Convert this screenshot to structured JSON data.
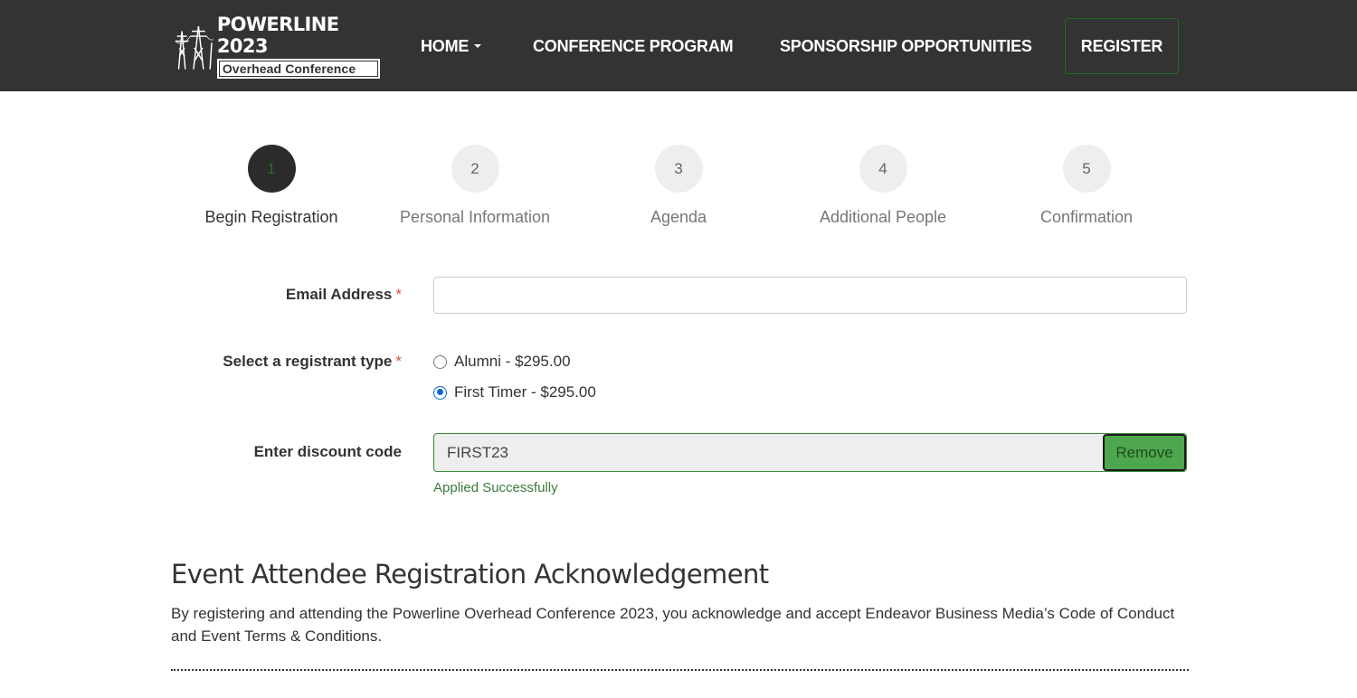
{
  "header": {
    "logo_title": "POWERLINE 2023",
    "logo_subtitle": "Overhead Conference",
    "nav": {
      "home": "HOME",
      "program": "CONFERENCE PROGRAM",
      "sponsorship": "SPONSORSHIP OPPORTUNITIES",
      "register": "REGISTER"
    }
  },
  "steps": [
    {
      "number": "1",
      "label": "Begin Registration",
      "active": true
    },
    {
      "number": "2",
      "label": "Personal Information",
      "active": false
    },
    {
      "number": "3",
      "label": "Agenda",
      "active": false
    },
    {
      "number": "4",
      "label": "Additional People",
      "active": false
    },
    {
      "number": "5",
      "label": "Confirmation",
      "active": false
    }
  ],
  "form": {
    "email_label": "Email Address",
    "email_value": "",
    "required_mark": "*",
    "registrant_label": "Select a registrant type",
    "options": [
      {
        "label": "Alumni - $295.00",
        "selected": false
      },
      {
        "label": "First Timer - $295.00",
        "selected": true
      }
    ],
    "discount_label": "Enter discount code",
    "discount_value": "FIRST23",
    "remove_label": "Remove",
    "applied_text": "Applied Successfully"
  },
  "acknowledgement": {
    "title": "Event Attendee Registration Acknowledgement",
    "body": "By registering and attending the Powerline Overhead Conference 2023, you acknowledge and accept Endeavor Business Media’s Code of Conduct and Event Terms & Conditions."
  },
  "colors": {
    "header_bg": "#333333",
    "accent_green": "#4ea64e",
    "required_red": "#d9534f",
    "radio_blue": "#0a66d8"
  }
}
